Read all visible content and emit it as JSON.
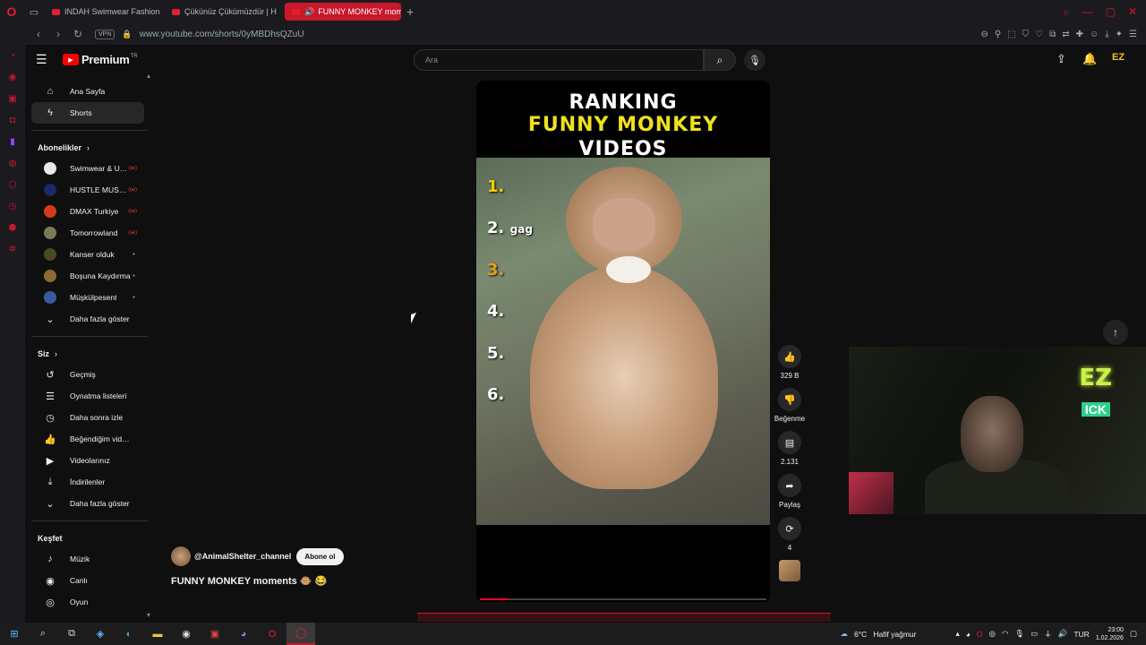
{
  "browser": {
    "tabs": [
      {
        "label": "INDAH Swimwear Fashion"
      },
      {
        "label": "Çükünüz Çükümüzdür | H"
      },
      {
        "label": "FUNNY MONKEY mom"
      }
    ],
    "url": "www.youtube.com/shorts/0yMBDhsQZuU",
    "vpn_label": "VPN"
  },
  "youtube": {
    "logo_text": "Premium",
    "logo_region": "TR",
    "search_placeholder": "Ara"
  },
  "sidebar": {
    "home": "Ana Sayfa",
    "shorts": "Shorts",
    "subscriptions_head": "Abonelikler",
    "subscriptions": [
      {
        "label": "Swimwear & Und...",
        "color": "#e8e8e8",
        "badge": "live"
      },
      {
        "label": "HUSTLE MUSIC (...",
        "color": "#1a2a6a",
        "badge": "live"
      },
      {
        "label": "DMAX Turkiye",
        "color": "#d43a1a",
        "badge": "live"
      },
      {
        "label": "Tomorrowland",
        "color": "#7a7a5a",
        "badge": "live"
      },
      {
        "label": "Kanser olduk",
        "color": "#4a4a20",
        "badge": "dot"
      },
      {
        "label": "Boşuna Kaydırma",
        "color": "#8a6a30",
        "badge": "dot"
      },
      {
        "label": "Müşkülpesent",
        "color": "#3a5aa0",
        "badge": "dot"
      }
    ],
    "show_more": "Daha fazla göster",
    "you_head": "Siz",
    "you_items": [
      {
        "label": "Geçmiş",
        "icon": "history-icon",
        "glyph": "↺"
      },
      {
        "label": "Oynatma listeleri",
        "icon": "playlist-icon",
        "glyph": "☰"
      },
      {
        "label": "Daha sonra izle",
        "icon": "clock-icon",
        "glyph": "◷"
      },
      {
        "label": "Beğendiğim videolar",
        "icon": "thumbs-up-icon",
        "glyph": "👍"
      },
      {
        "label": "Videolarınız",
        "icon": "video-icon",
        "glyph": "▶"
      },
      {
        "label": "İndirilenler",
        "icon": "download-icon",
        "glyph": "⤓"
      }
    ],
    "show_more_2": "Daha fazla göster",
    "explore_head": "Keşfet",
    "explore_items": [
      {
        "label": "Müzik",
        "icon": "music-icon",
        "glyph": "♪"
      },
      {
        "label": "Canlı",
        "icon": "live-icon",
        "glyph": "◉"
      },
      {
        "label": "Oyun",
        "icon": "gaming-icon",
        "glyph": "◎"
      }
    ]
  },
  "short": {
    "title_line1": "RANKING",
    "title_line2": "FUNNY MONKEY",
    "title_line3": "VIDEOS",
    "ranks": [
      "1.",
      "2.",
      "3.",
      "4.",
      "5.",
      "6."
    ],
    "rank2_suffix": "gag",
    "channel": "@AnimalShelter_channel",
    "subscribe": "Abone ol",
    "caption": "FUNNY MONKEY moments 🐵 😂",
    "progress": 0.1
  },
  "actions": {
    "likes": "329 B",
    "dislike": "Beğenme",
    "comments": "2.131",
    "share": "Paylaş",
    "remix": "4"
  },
  "webcam": {
    "logo": "EZ",
    "logo_sub": "ICK"
  },
  "taskbar": {
    "weather_temp": "6°C",
    "weather_text": "Hafif yağmur",
    "lang": "TUR",
    "time": "23:00",
    "date": "1.02.2026"
  }
}
